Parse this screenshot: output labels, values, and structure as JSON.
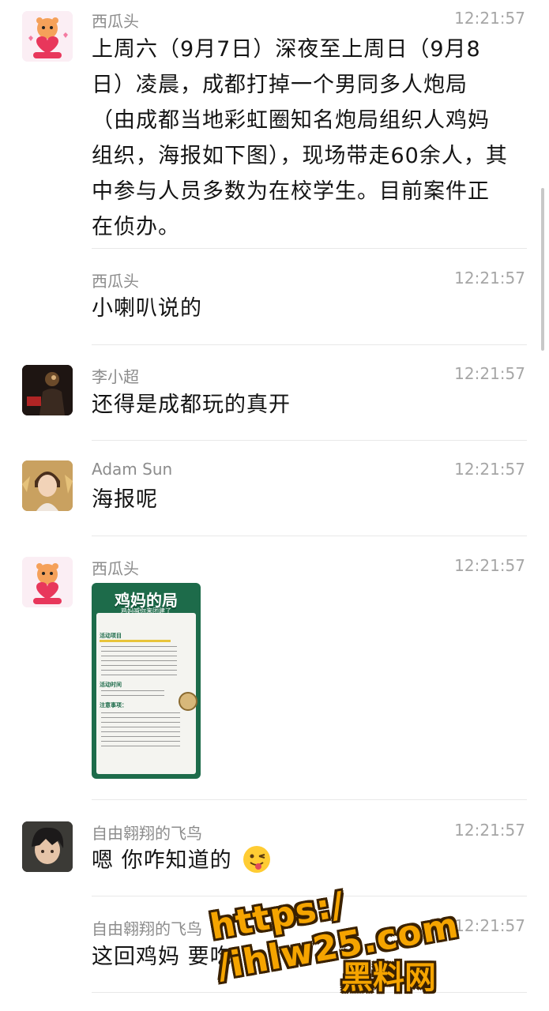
{
  "colors": {
    "watermark": "#f5a400",
    "poster_green": "#1d6b4a",
    "name_gray": "#8c8c8c"
  },
  "messages": [
    {
      "sender": "西瓜头",
      "time": "12:21:57",
      "text": "上周六（9月7日）深夜至上周日（9月8日）凌晨，成都打掉一个男同多人炮局（由成都当地彩虹圈知名炮局组织人鸡妈组织，海报如下图），现场带走60余人，其中参与人员多数为在校学生。目前案件正在侦办。",
      "avatar": "tiger-avatar"
    },
    {
      "sender": "西瓜头",
      "time": "12:21:57",
      "text": "小喇叭说的"
    },
    {
      "sender": "李小超",
      "time": "12:21:57",
      "text": "还得是成都玩的真开",
      "avatar": "dark-avatar"
    },
    {
      "sender": "Adam Sun",
      "time": "12:21:57",
      "text": "海报呢",
      "avatar": "anime-avatar"
    },
    {
      "sender": "西瓜头",
      "time": "12:21:57",
      "avatar": "tiger-avatar",
      "image": {
        "title": "鸡妈的局",
        "subtitle": "鸡妈喊你来团建了",
        "sec1": "活动项目",
        "sec2": "活动时间",
        "sec3": "注意事项："
      }
    },
    {
      "sender": "自由翱翔的飞鸟",
      "time": "12:21:57",
      "text": "嗯 你咋知道的",
      "emoji": "winking-tongue-emoji",
      "avatar": "boy-avatar"
    },
    {
      "sender": "自由翱翔的飞鸟",
      "time": "12:21:57",
      "text": "这回鸡妈 要吃"
    }
  ],
  "watermark": {
    "url": "https:/ /ihlw25.com",
    "site": "黑料网"
  }
}
